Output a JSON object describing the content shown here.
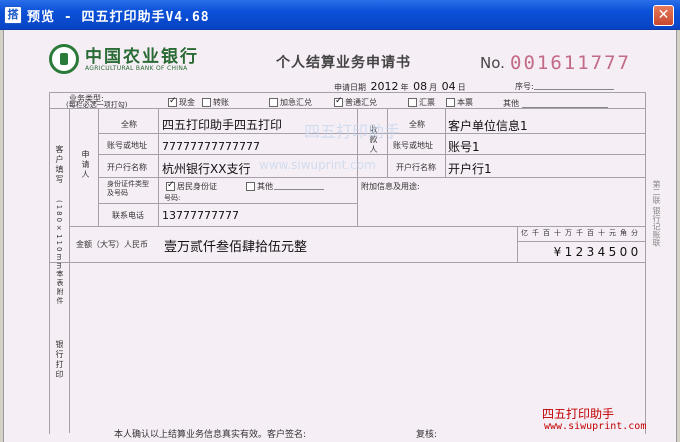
{
  "window": {
    "app_icon": "搭",
    "title": "预览 - 四五打印助手V4.68",
    "close_glyph": "✕"
  },
  "header": {
    "bank_name_cn": "中国农业银行",
    "bank_name_en": "AGRICULTURAL BANK OF CHINA",
    "form_title": "个人结算业务申请书",
    "no_label": "No.",
    "form_number": "001611777",
    "date_label": "申请日期",
    "date_year": "2012",
    "date_year_unit": "年",
    "date_month": "08",
    "date_month_unit": "月",
    "date_day": "04",
    "date_day_unit": "日",
    "seq_label": "序号:"
  },
  "business_type": {
    "label1": "业务类型:",
    "label2": "(每栏必选一项打勾)",
    "options": [
      {
        "label": "现金",
        "checked": true
      },
      {
        "label": "转账",
        "checked": false
      },
      {
        "label": "加急汇兑",
        "checked": false
      },
      {
        "label": "普通汇兑",
        "checked": true
      },
      {
        "label": "汇票",
        "checked": false
      },
      {
        "label": "本票",
        "checked": false
      }
    ],
    "other_label": "其他"
  },
  "customer_section": {
    "customer_fill_label": "客户填写",
    "applicant_label": "申请人",
    "payee_label": "收款人",
    "fields": {
      "name_label": "全称",
      "account_label": "账号或地址",
      "bank_label": "开户行名称",
      "id_type_label": "身份证件类型及号码",
      "id_option_resident": "居民身份证",
      "id_option_other": "其他",
      "id_number_label": "号码:",
      "phone_label": "联系电话",
      "extra_label": "附加信息及用途:"
    },
    "applicant": {
      "name": "四五打印助手四五打印",
      "account": "77777777777777",
      "bank": "杭州银行XX支行",
      "id_checked": true,
      "phone": "13777777777"
    },
    "payee": {
      "name": "客户单位信息1",
      "account": "账号1",
      "bank": "开户行1"
    }
  },
  "amount": {
    "label": "金额（大写）人民币",
    "uppercase": "壹万贰仟叁佰肆拾伍元整",
    "unit_headers": [
      "亿",
      "千",
      "百",
      "十",
      "万",
      "千",
      "百",
      "十",
      "元",
      "角",
      "分"
    ],
    "digits": [
      "",
      "",
      "",
      "¥",
      "1",
      "2",
      "3",
      "4",
      "5",
      "0",
      "0"
    ]
  },
  "bank_section": {
    "label": "银行打印",
    "size_note": "(180×110mm)",
    "form_note": "本表附件"
  },
  "side_note": "第二联 银行记账联",
  "footer": {
    "confirm_text": "本人确认以上结算业务信息真实有效。客户签名:",
    "review_text": "复核:",
    "brand": "四五打印助手",
    "url": "www.siwuprint.com",
    "watermark_left": "四五打印助手",
    "watermark_url": "www.siwuprint.com"
  }
}
